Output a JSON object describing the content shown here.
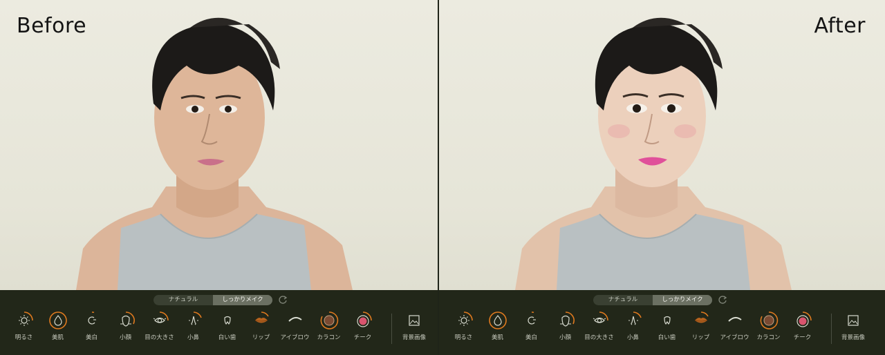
{
  "before": {
    "label": "Before",
    "mode_toggle": {
      "natural": "ナチュラル",
      "full_makeup": "しっかりメイク",
      "active": "full_makeup"
    },
    "tools": [
      {
        "label": "明るさ",
        "icon": "sun-icon"
      },
      {
        "label": "美肌",
        "icon": "drop-icon"
      },
      {
        "label": "美白",
        "icon": "sparkle-icon"
      },
      {
        "label": "小顔",
        "icon": "face-icon"
      },
      {
        "label": "目の大きさ",
        "icon": "eye-icon"
      },
      {
        "label": "小鼻",
        "icon": "nose-icon"
      },
      {
        "label": "白い歯",
        "icon": "tooth-icon"
      },
      {
        "label": "リップ",
        "icon": "lips-icon"
      },
      {
        "label": "アイブロウ",
        "icon": "eyebrow-icon"
      },
      {
        "label": "カラコン",
        "icon": "contact-lens-icon"
      },
      {
        "label": "チーク",
        "icon": "blush-icon"
      }
    ],
    "background_tool": {
      "label": "背景画像",
      "icon": "image-icon"
    }
  },
  "after": {
    "label": "After",
    "mode_toggle": {
      "natural": "ナチュラル",
      "full_makeup": "しっかりメイク",
      "active": "full_makeup"
    },
    "tools": [
      {
        "label": "明るさ",
        "icon": "sun-icon"
      },
      {
        "label": "美肌",
        "icon": "drop-icon"
      },
      {
        "label": "美白",
        "icon": "sparkle-icon"
      },
      {
        "label": "小顔",
        "icon": "face-icon"
      },
      {
        "label": "目の大きさ",
        "icon": "eye-icon"
      },
      {
        "label": "小鼻",
        "icon": "nose-icon"
      },
      {
        "label": "白い歯",
        "icon": "tooth-icon"
      },
      {
        "label": "リップ",
        "icon": "lips-icon"
      },
      {
        "label": "アイブロウ",
        "icon": "eyebrow-icon"
      },
      {
        "label": "カラコン",
        "icon": "contact-lens-icon"
      },
      {
        "label": "チーク",
        "icon": "blush-icon"
      }
    ],
    "background_tool": {
      "label": "背景画像",
      "icon": "image-icon"
    }
  },
  "colors": {
    "accent": "#e07a1f",
    "toolbar_bg": "#222719",
    "photo_bg": "#e9e8dc",
    "lip_before": "#c9708a",
    "lip_after": "#e0509a"
  }
}
